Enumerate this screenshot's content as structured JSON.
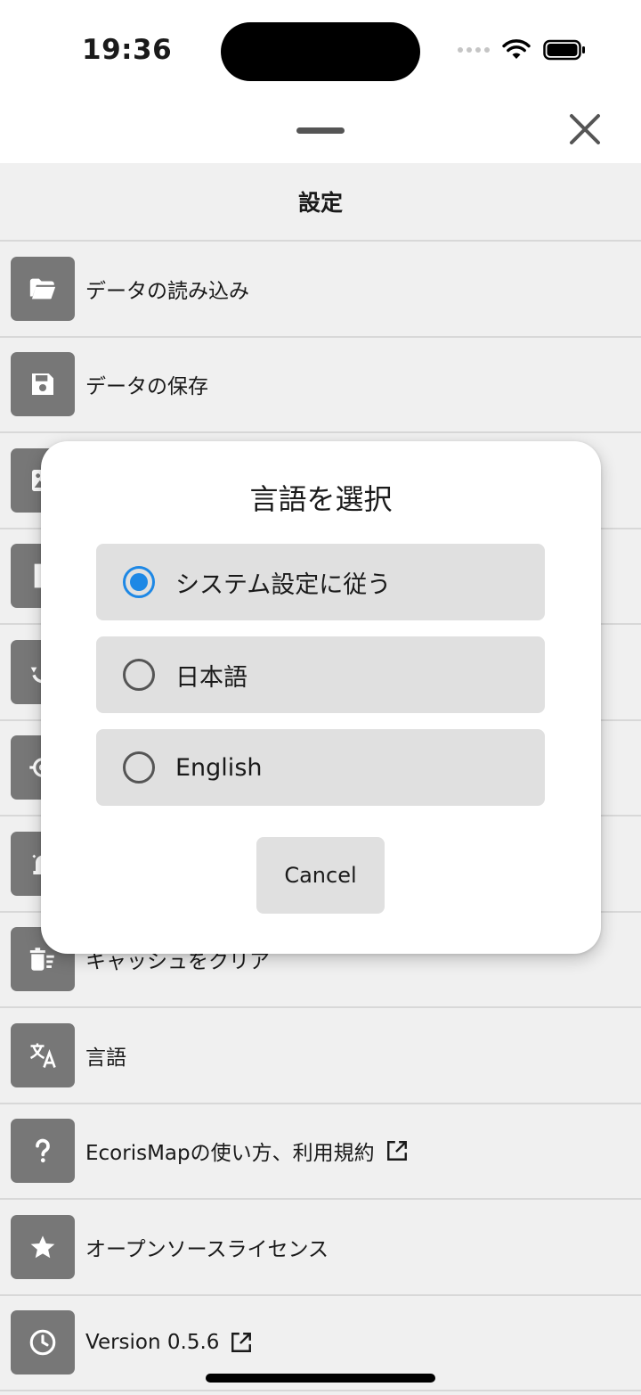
{
  "status_bar": {
    "time": "19:36",
    "icons": [
      "signal-dots-icon",
      "wifi-icon",
      "battery-icon"
    ]
  },
  "sheet": {
    "icons": [
      "grabber-handle",
      "close-icon"
    ]
  },
  "settings": {
    "title": "設定",
    "items": [
      {
        "icon": "folder-open-icon",
        "label": "データの読み込み",
        "external": false
      },
      {
        "icon": "save-icon",
        "label": "データの保存",
        "external": false
      },
      {
        "icon": "image-icon",
        "label": "",
        "external": false
      },
      {
        "icon": "document-icon",
        "label": "",
        "external": false
      },
      {
        "icon": "restore-icon",
        "label": "",
        "external": false
      },
      {
        "icon": "location-icon",
        "label": "",
        "external": false
      },
      {
        "icon": "alert-icon",
        "label": "",
        "external": false
      },
      {
        "icon": "delete-sweep-icon",
        "label": "キャッシュをクリア",
        "external": false
      },
      {
        "icon": "translate-icon",
        "label": "言語",
        "external": false
      },
      {
        "icon": "help-icon",
        "label": "EcorisMapの使い方、利用規約",
        "external": true
      },
      {
        "icon": "star-icon",
        "label": "オープンソースライセンス",
        "external": false
      },
      {
        "icon": "clock-icon",
        "label": "Version 0.5.6",
        "external": true
      }
    ]
  },
  "dialog": {
    "title": "言語を選択",
    "options": [
      {
        "label": "システム設定に従う",
        "selected": true
      },
      {
        "label": "日本語",
        "selected": false
      },
      {
        "label": "English",
        "selected": false
      }
    ],
    "cancel_label": "Cancel"
  },
  "colors": {
    "accent": "#1e88e5",
    "icon_tile": "#777777",
    "list_background": "#f0f0f0",
    "option_background": "#e0e0e0"
  }
}
